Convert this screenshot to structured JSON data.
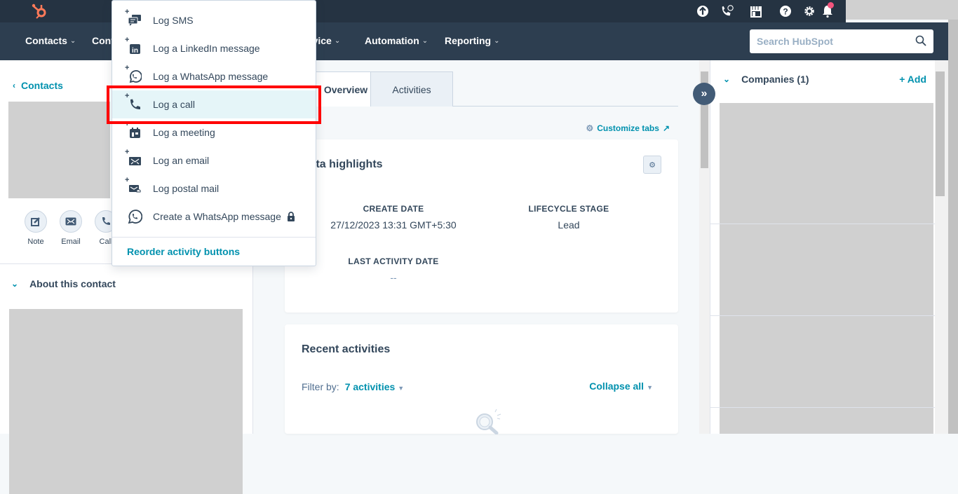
{
  "topbar": {
    "icons": [
      "upgrade-icon",
      "calling-icon",
      "marketplace-icon",
      "help-icon",
      "settings-icon",
      "notifications-icon"
    ],
    "notification_dot_color": "#f2547d"
  },
  "nav": {
    "items": [
      {
        "label": "Contacts"
      },
      {
        "label": "Conversations"
      },
      {
        "label": "Service"
      },
      {
        "label": "Automation"
      },
      {
        "label": "Reporting"
      }
    ],
    "search_placeholder": "Search HubSpot"
  },
  "left": {
    "back_label": "Contacts",
    "actions": [
      {
        "label": "Note",
        "icon": "note-icon"
      },
      {
        "label": "Email",
        "icon": "email-icon"
      },
      {
        "label": "Call",
        "icon": "call-icon"
      }
    ],
    "about_label": "About this contact"
  },
  "dropdown": {
    "items": [
      {
        "label": "Log SMS",
        "icon": "sms-icon"
      },
      {
        "label": "Log a LinkedIn message",
        "icon": "linkedin-icon"
      },
      {
        "label": "Log a WhatsApp message",
        "icon": "whatsapp-icon"
      },
      {
        "label": "Log a call",
        "icon": "call-icon",
        "highlighted": true
      },
      {
        "label": "Log a meeting",
        "icon": "calendar-icon"
      },
      {
        "label": "Log an email",
        "icon": "email-icon"
      },
      {
        "label": "Log postal mail",
        "icon": "postal-mail-icon"
      },
      {
        "label": "Create a WhatsApp message",
        "icon": "whatsapp-icon",
        "locked": true
      }
    ],
    "footer_label": "Reorder activity buttons"
  },
  "middle": {
    "tabs": [
      {
        "label": "Overview",
        "active": true
      },
      {
        "label": "Activities",
        "active": false
      }
    ],
    "customize_label": "Customize tabs",
    "highlights": {
      "title": "Data highlights",
      "properties": [
        {
          "label": "CREATE DATE",
          "value": "27/12/2023 13:31 GMT+5:30"
        },
        {
          "label": "LIFECYCLE STAGE",
          "value": "Lead"
        },
        {
          "label": "LAST ACTIVITY DATE",
          "value": "--"
        }
      ]
    },
    "recent": {
      "title": "Recent activities",
      "filter_label": "Filter by:",
      "filter_value": "7 activities",
      "collapse_label": "Collapse all"
    }
  },
  "right": {
    "companies_label": "Companies (1)",
    "add_label": "+ Add"
  },
  "colors": {
    "accent": "#0091ae",
    "nav_bg": "#2d3e50",
    "topbar_bg": "#253342",
    "highlight_border": "#ff0000",
    "logo": "#ff7a59"
  }
}
